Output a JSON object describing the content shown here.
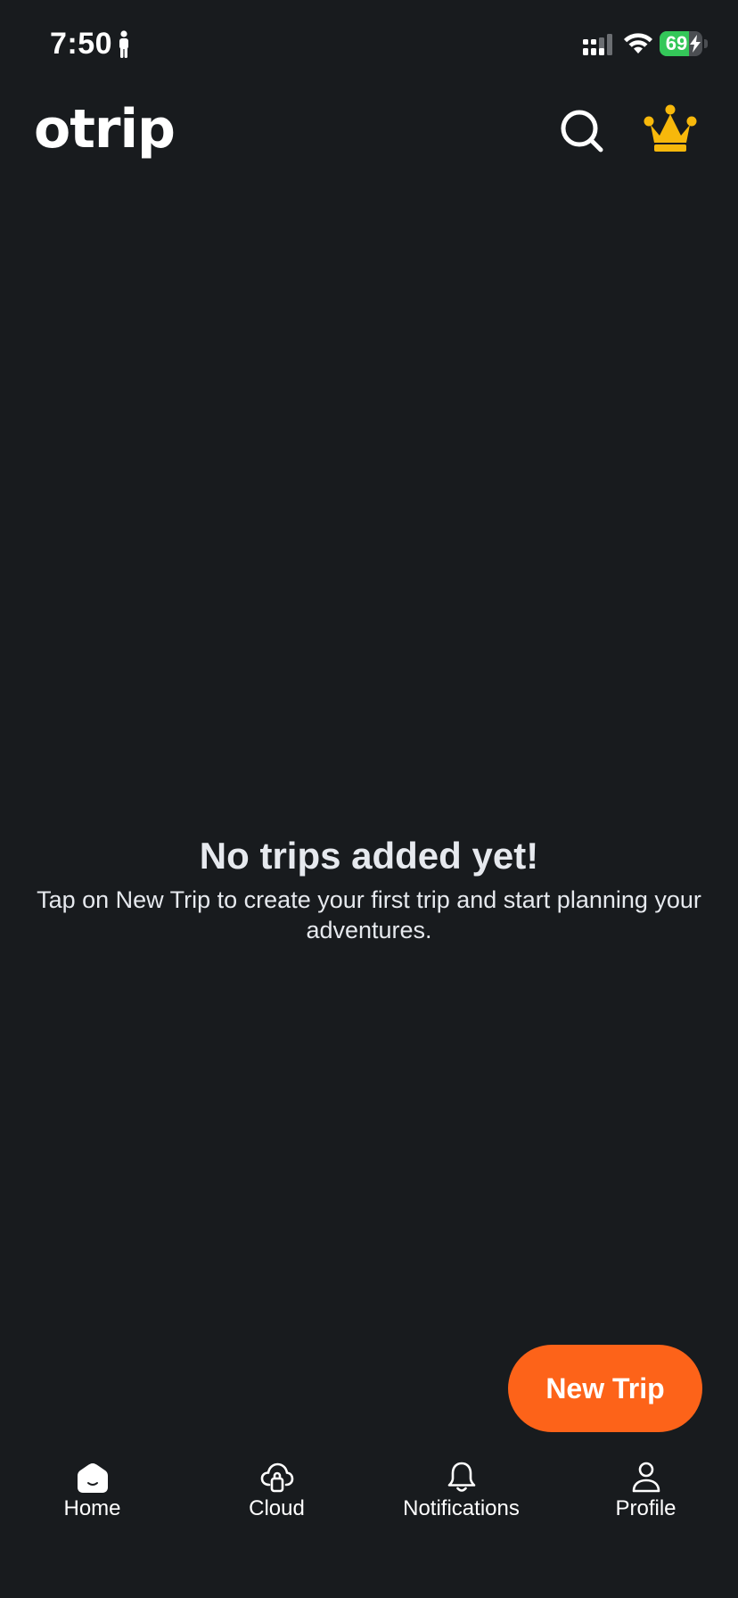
{
  "status_bar": {
    "time": "7:50",
    "battery_percent": "69",
    "battery_level": 0.69,
    "battery_charging": true
  },
  "header": {
    "logo_text": "otrip",
    "search_icon": "search-icon",
    "premium_icon": "crown-icon"
  },
  "empty_state": {
    "title": "No trips added yet!",
    "subtitle": "Tap on New Trip to create your first trip and start planning your adventures."
  },
  "fab": {
    "label": "New Trip",
    "color": "#fd6319"
  },
  "tab_bar": {
    "items": [
      {
        "label": "Home",
        "icon": "home-icon",
        "active": true
      },
      {
        "label": "Cloud",
        "icon": "cloud-icon",
        "active": false
      },
      {
        "label": "Notifications",
        "icon": "bell-icon",
        "active": false
      },
      {
        "label": "Profile",
        "icon": "person-icon",
        "active": false
      }
    ]
  },
  "colors": {
    "background": "#181b1e",
    "accent": "#fd6319",
    "crown": "#f7b80b",
    "battery_green": "#34c759"
  }
}
